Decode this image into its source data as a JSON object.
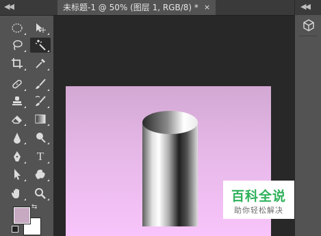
{
  "toolbar": {
    "collapse_label": "◀◀",
    "tools": [
      {
        "name": "marquee-tool",
        "icon": "marquee-icon"
      },
      {
        "name": "move-tool",
        "icon": "move-icon"
      },
      {
        "name": "lasso-tool",
        "icon": "lasso-icon"
      },
      {
        "name": "magic-wand-tool",
        "icon": "magic-wand-icon",
        "active": true
      },
      {
        "name": "crop-tool",
        "icon": "crop-icon"
      },
      {
        "name": "eyedropper-tool",
        "icon": "eyedropper-icon"
      },
      {
        "name": "spot-healing-tool",
        "icon": "bandage-icon"
      },
      {
        "name": "brush-tool",
        "icon": "brush-icon"
      },
      {
        "name": "clone-stamp-tool",
        "icon": "stamp-icon"
      },
      {
        "name": "history-brush-tool",
        "icon": "history-brush-icon"
      },
      {
        "name": "eraser-tool",
        "icon": "eraser-icon"
      },
      {
        "name": "gradient-tool",
        "icon": "gradient-icon"
      },
      {
        "name": "blur-tool",
        "icon": "blur-drop-icon"
      },
      {
        "name": "dodge-tool",
        "icon": "dodge-icon"
      },
      {
        "name": "pen-tool",
        "icon": "pen-icon"
      },
      {
        "name": "type-tool",
        "icon": "type-icon",
        "glyph": "T"
      },
      {
        "name": "path-selection-tool",
        "icon": "arrow-icon"
      },
      {
        "name": "custom-shape-tool",
        "icon": "shape-icon"
      },
      {
        "name": "hand-tool",
        "icon": "hand-icon"
      },
      {
        "name": "zoom-tool",
        "icon": "zoom-icon"
      }
    ],
    "foreground_color": "#c7a9c2",
    "background_color": "#ffffff"
  },
  "document_tab": {
    "title": "未标题-1 @ 50% (图层 1, RGB/8) *",
    "close_label": "×"
  },
  "document": {
    "gradient_colors": [
      "#d3a8d3",
      "#f8c4fb"
    ]
  },
  "right_panel": {
    "collapse_label": "◀◀",
    "icon": "3d-cube-icon"
  },
  "watermark": {
    "title": "百科全说",
    "subtitle": "助你轻松解决"
  }
}
